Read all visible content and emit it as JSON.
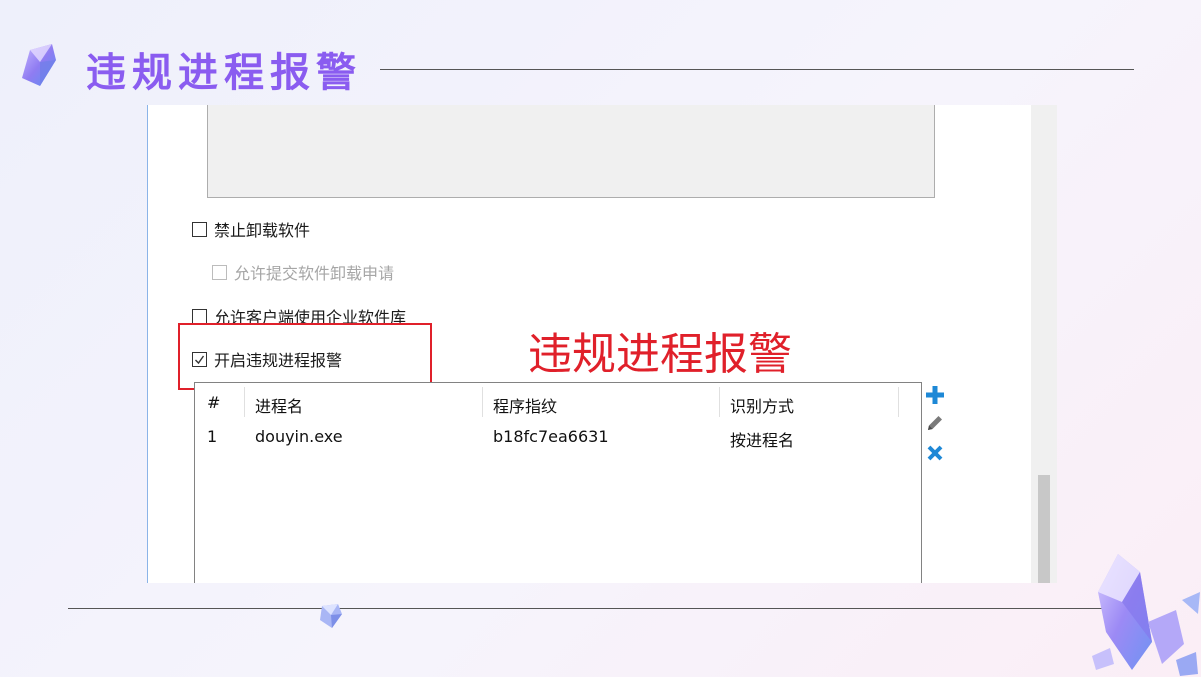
{
  "slide": {
    "title": "违规进程报警",
    "annotation": "违规进程报警"
  },
  "options": {
    "forbid_uninstall": {
      "label": "禁止卸载软件",
      "checked": false
    },
    "allow_uninstall_request": {
      "label": "允许提交软件卸载申请",
      "checked": false,
      "disabled": true
    },
    "allow_enterprise_library": {
      "label": "允许客户端使用企业软件库",
      "checked": false
    },
    "enable_violation_alarm": {
      "label": "开启违规进程报警",
      "checked": true
    }
  },
  "process_table": {
    "columns": [
      "#",
      "进程名",
      "程序指纹",
      "识别方式"
    ],
    "rows": [
      {
        "index": "1",
        "name": "douyin.exe",
        "fingerprint": "b18fc7ea6631",
        "method": "按进程名"
      }
    ]
  },
  "toolbar": {
    "add_icon": "plus-icon",
    "edit_icon": "pencil-icon",
    "delete_icon": "close-icon"
  },
  "colors": {
    "title": "#8a5cf0",
    "annotation": "#e0202a",
    "tool_blue": "#1e88d6"
  }
}
